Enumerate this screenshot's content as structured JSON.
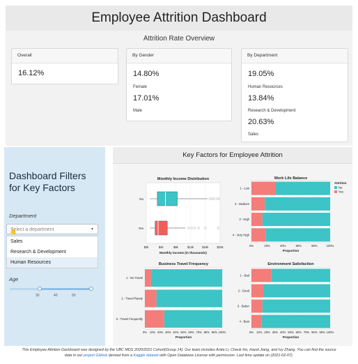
{
  "header": {
    "title": "Employee Attrition Dashboard"
  },
  "overview": {
    "title": "Attrition Rate Overview",
    "overall": {
      "label": "Overall",
      "value": "16.12%"
    },
    "gender": {
      "label": "By Gender",
      "items": [
        {
          "value": "14.80%",
          "name": "Female"
        },
        {
          "value": "17.01%",
          "name": "Male"
        }
      ]
    },
    "department": {
      "label": "By Department",
      "items": [
        {
          "value": "19.05%",
          "name": "Human Resources"
        },
        {
          "value": "13.84%",
          "name": "Research & Development"
        },
        {
          "value": "20.63%",
          "name": "Sales"
        }
      ]
    }
  },
  "filters": {
    "title_line1": "Dashboard Filters",
    "title_line2": "for Key Factors",
    "department_label": "Department",
    "department_placeholder": "Select a department",
    "options": [
      "Sales",
      "Research & Development",
      "Human Resources"
    ],
    "age_label": "Age",
    "age_ticks": [
      "30",
      "40",
      "50"
    ]
  },
  "factors": {
    "title": "Key Factors for Employee Attrition"
  },
  "colors": {
    "no": "#3cc4c6",
    "yes": "#f47c79",
    "income_yes": "#f0605b"
  },
  "chart_data": [
    {
      "type": "box",
      "title": "Monthly Income Distribution",
      "xlabel": "Monthly Income (in thousands)",
      "categories": [
        "No",
        "Yes"
      ],
      "xticks": [
        "$0k",
        "$4k",
        "$8k",
        "$12k",
        "$16k",
        "$20k"
      ],
      "xlim": [
        0,
        20
      ],
      "boxes": [
        {
          "name": "No",
          "whisker_low": 1,
          "q1": 3,
          "median": 5.2,
          "q3": 8.4,
          "whisker_high": 16.6,
          "outliers": [
            17.2,
            17.8,
            18.4,
            19.2,
            19.7
          ]
        },
        {
          "name": "Yes",
          "whisker_low": 1,
          "q1": 2.4,
          "median": 3.2,
          "q3": 5.7,
          "whisker_high": 10.6,
          "outliers": [
            11.5,
            12.3,
            13.1,
            14.2,
            16.0,
            19.5
          ]
        }
      ]
    },
    {
      "type": "stacked_bar_h",
      "title": "Work Life Balance",
      "xlabel": "Proportion",
      "categories": [
        "1 - Low",
        "2 - Medium",
        "3 - High",
        "4 - Very High"
      ],
      "xticks": [
        "0%",
        "20%",
        "40%",
        "60%",
        "80%",
        "100%"
      ],
      "series": [
        {
          "name": "No",
          "values": [
            0.69,
            0.83,
            0.86,
            0.82
          ]
        },
        {
          "name": "Yes",
          "values": [
            0.31,
            0.17,
            0.14,
            0.18
          ]
        }
      ],
      "legend": {
        "title": "Attrition",
        "position": "right"
      }
    },
    {
      "type": "stacked_bar_h",
      "title": "Business Travel Frequency",
      "xlabel": "Proportion",
      "categories": [
        "1 - No Travel",
        "2 - Travel Rarely",
        "3 - Travel Frequently"
      ],
      "xticks": [
        "0%",
        "10%",
        "20%",
        "30%",
        "40%",
        "50%",
        "60%",
        "70%",
        "80%",
        "90%",
        "100%"
      ],
      "series": [
        {
          "name": "No",
          "values": [
            0.92,
            0.85,
            0.75
          ]
        },
        {
          "name": "Yes",
          "values": [
            0.08,
            0.15,
            0.25
          ]
        }
      ]
    },
    {
      "type": "stacked_bar_h",
      "title": "Environment Satisfaction",
      "xlabel": "Proportion",
      "categories": [
        "1 - Bad",
        "2 - Good",
        "3 - Better",
        "4 - Best"
      ],
      "xticks": [
        "0%",
        "10%",
        "20%",
        "30%",
        "40%",
        "50%",
        "60%",
        "70%",
        "80%",
        "90%",
        "100%"
      ],
      "series": [
        {
          "name": "No",
          "values": [
            0.75,
            0.85,
            0.86,
            0.87
          ]
        },
        {
          "name": "Yes",
          "values": [
            0.25,
            0.15,
            0.14,
            0.13
          ]
        }
      ]
    }
  ],
  "footer": {
    "line1": "This Employee Attrition Dashboard was designed by the UBC MDS 2020/2021 Cohort(Group 14). Our team includes Anita Li, Cheuk Ho, Hazel Jiang, and Ivy Zhang. You can find the source",
    "line2_a": "data in our ",
    "link1": "project GitHub",
    "line2_b": " derived from a ",
    "link2": "Kaggle dataset",
    "line2_c": " with Open Database License with permission. Last time update on (2021-02-07)."
  }
}
